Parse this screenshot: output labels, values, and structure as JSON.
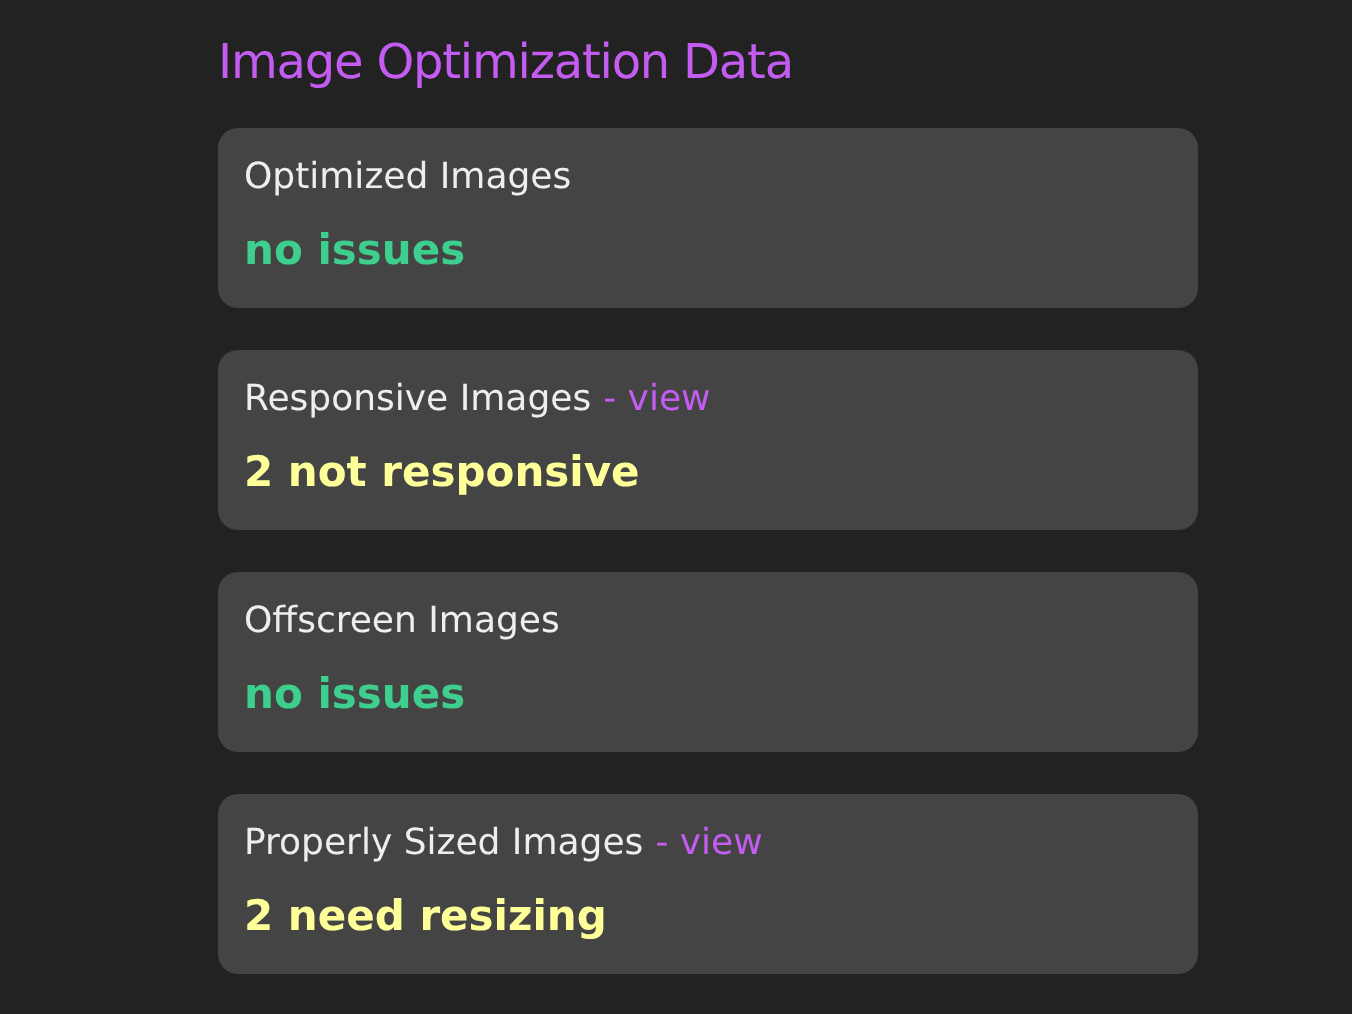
{
  "title": "Image Optimization Data",
  "cards": [
    {
      "label": "Optimized Images",
      "result": "no issues",
      "kind": "ok"
    },
    {
      "label": "Responsive Images",
      "link": "- view",
      "result": "2 not responsive",
      "kind": "warn"
    },
    {
      "label": "Offscreen Images",
      "result": "no issues",
      "kind": "ok"
    },
    {
      "label": "Properly Sized Images",
      "link": "- view",
      "result": "2 need resizing",
      "kind": "warn"
    }
  ]
}
